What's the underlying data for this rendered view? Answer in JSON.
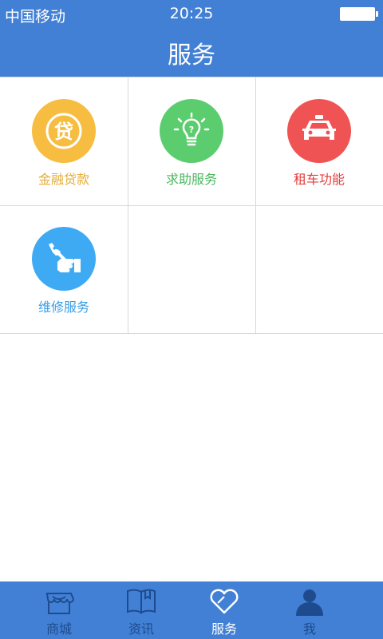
{
  "status_bar": {
    "carrier": "中国移动",
    "time": "20:25"
  },
  "header": {
    "title": "服务"
  },
  "services": [
    {
      "label": "金融贷款",
      "icon": "loan-icon",
      "color": "#f6bd41",
      "text_color": "#e4ad34"
    },
    {
      "label": "求助服务",
      "icon": "lightbulb-question-icon",
      "color": "#5ccd6e",
      "text_color": "#4cb760"
    },
    {
      "label": "租车功能",
      "icon": "car-icon",
      "color": "#f05353",
      "text_color": "#e33d3d"
    },
    {
      "label": "维修服务",
      "icon": "wrench-hand-icon",
      "color": "#3eaaf3",
      "text_color": "#3a9ee6"
    }
  ],
  "tabbar": {
    "items": [
      {
        "label": "商城",
        "icon": "store-icon"
      },
      {
        "label": "资讯",
        "icon": "book-icon"
      },
      {
        "label": "服务",
        "icon": "heart-icon",
        "active": true
      },
      {
        "label": "我",
        "icon": "person-icon"
      }
    ]
  },
  "colors": {
    "primary": "#4280d5",
    "tab_inactive": "#1d4b8e",
    "divider": "#d8d8d8"
  }
}
